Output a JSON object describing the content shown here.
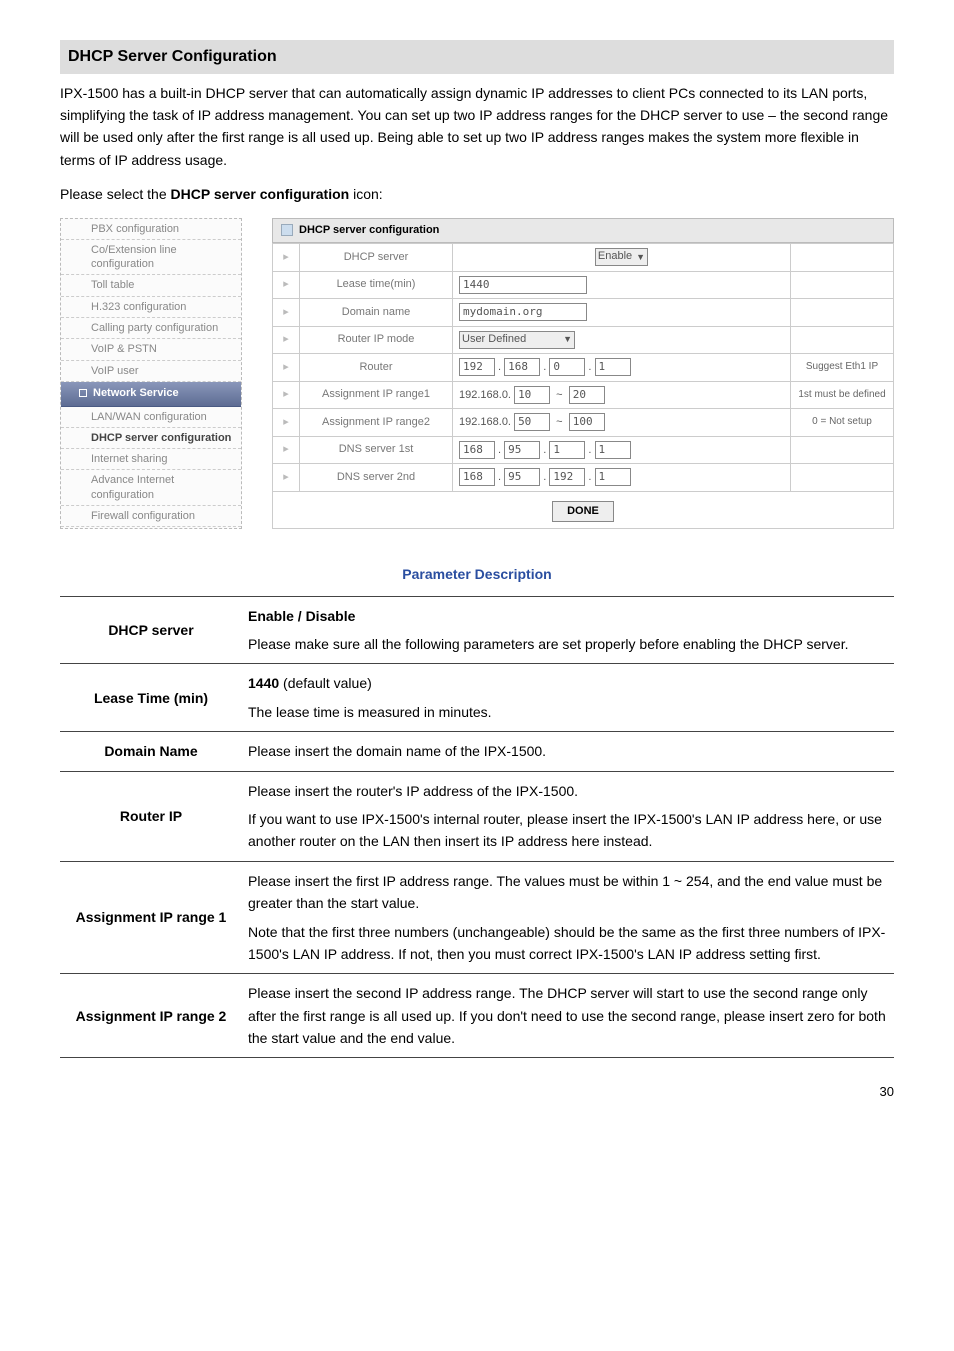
{
  "section_title": "DHCP Server Configuration",
  "intro": "IPX-1500 has a built-in DHCP server that can automatically assign dynamic IP addresses to client PCs connected to its LAN ports, simplifying the task of IP address management. You can set up two IP address ranges for the DHCP server to use – the second range will be used only after the first range is all used up. Being able to set up two IP address ranges makes the system more flexible in terms of IP address usage.",
  "select_text_pre": "Please select the ",
  "select_text_bold": "DHCP server configuration",
  "select_text_post": " icon:",
  "sidebar": {
    "items_top": [
      "PBX configuration",
      "Co/Extension line configuration",
      "Toll table",
      "H.323 configuration",
      "Calling party configuration",
      "VoIP & PSTN",
      "VoIP user"
    ],
    "header": "Network Service",
    "items_bottom": [
      {
        "label": "LAN/WAN configuration",
        "bold": false
      },
      {
        "label": "DHCP server configuration",
        "bold": true
      },
      {
        "label": "Internet sharing",
        "bold": false
      },
      {
        "label": "Advance Internet configuration",
        "bold": false
      },
      {
        "label": "Firewall configuration",
        "bold": false
      }
    ]
  },
  "config": {
    "title": "DHCP server configuration",
    "rows": {
      "dhcp_server": {
        "label": "DHCP server",
        "select": "Enable"
      },
      "lease": {
        "label": "Lease time(min)",
        "value": "1440"
      },
      "domain": {
        "label": "Domain name",
        "value": "mydomain.org"
      },
      "router_mode": {
        "label": "Router IP mode",
        "select": "User Defined"
      },
      "router": {
        "label": "Router",
        "o1": "192",
        "o2": "168",
        "o3": "0",
        "o4": "1",
        "note": "Suggest Eth1 IP"
      },
      "range1": {
        "label": "Assignment IP range1",
        "prefix": "192.168.0.",
        "from": "10",
        "to": "20",
        "note": "1st must be defined"
      },
      "range2": {
        "label": "Assignment IP range2",
        "prefix": "192.168.0.",
        "from": "50",
        "to": "100",
        "note": "0 = Not setup"
      },
      "dns1": {
        "label": "DNS server 1st",
        "o1": "168",
        "o2": "95",
        "o3": "1",
        "o4": "1"
      },
      "dns2": {
        "label": "DNS server 2nd",
        "o1": "168",
        "o2": "95",
        "o3": "192",
        "o4": "1"
      }
    },
    "done": "DONE"
  },
  "param_table": {
    "header": "Parameter Description",
    "rows": [
      {
        "name": "DHCP server",
        "desc": [
          {
            "bold": "Enable / Disable"
          },
          {
            "text": "Please make sure all the following parameters are set properly before enabling the DHCP server."
          }
        ]
      },
      {
        "name": "Lease Time (min)",
        "desc": [
          {
            "bold": "1440",
            "after": " (default value)"
          },
          {
            "text": "The lease time is measured in minutes."
          }
        ]
      },
      {
        "name": "Domain Name",
        "desc": [
          {
            "text": "Please insert the domain name of the IPX-1500."
          }
        ]
      },
      {
        "name": "Router IP",
        "desc": [
          {
            "text": "Please insert the router's IP address of the IPX-1500."
          },
          {
            "text": "If you want to use IPX-1500's internal router, please insert the IPX-1500's LAN IP address here, or use another router on the LAN then insert its IP address here instead."
          }
        ]
      },
      {
        "name": "Assignment IP range 1",
        "desc": [
          {
            "text": "Please insert the first IP address range. The values must be within 1 ~ 254, and the end value must be greater than the start value."
          },
          {
            "text": "Note that the first three numbers (unchangeable) should be the same as the first three numbers of IPX-1500's LAN IP address. If not, then you must correct IPX-1500's LAN IP address setting first."
          }
        ]
      },
      {
        "name": "Assignment IP range 2",
        "desc": [
          {
            "text": "Please insert the second IP address range. The DHCP server will start to use the second range only after the first range is all used up. If you don't need to use the second range, please insert zero for both the start value and the end value."
          }
        ]
      }
    ]
  },
  "page_number": "30"
}
